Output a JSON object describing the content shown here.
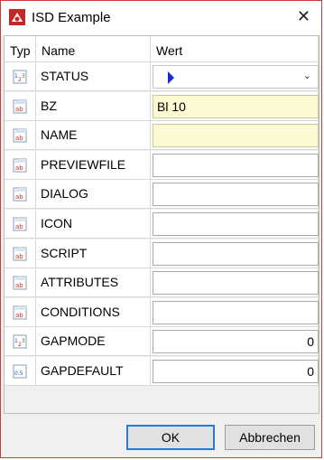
{
  "window": {
    "title": "ISD Example",
    "close_glyph": "✕"
  },
  "grid": {
    "headers": {
      "typ": "Typ",
      "name": "Name",
      "wert": "Wert"
    },
    "rows": [
      {
        "name": "STATUS",
        "icon": "numeric-value-icon",
        "value": "",
        "kind": "combo"
      },
      {
        "name": "BZ",
        "icon": "text-value-icon",
        "value": "Bl 10",
        "kind": "yellow"
      },
      {
        "name": "NAME",
        "icon": "text-value-icon",
        "value": "",
        "kind": "yellow"
      },
      {
        "name": "PREVIEWFILE",
        "icon": "text-value-icon",
        "value": "",
        "kind": "text"
      },
      {
        "name": "DIALOG",
        "icon": "text-value-icon",
        "value": "",
        "kind": "text"
      },
      {
        "name": "ICON",
        "icon": "text-value-icon",
        "value": "",
        "kind": "text"
      },
      {
        "name": "SCRIPT",
        "icon": "text-value-icon",
        "value": "",
        "kind": "text"
      },
      {
        "name": "ATTRIBUTES",
        "icon": "text-value-icon",
        "value": "",
        "kind": "text"
      },
      {
        "name": "CONDITIONS",
        "icon": "text-value-icon",
        "value": "",
        "kind": "text"
      },
      {
        "name": "GAPMODE",
        "icon": "numeric-value-icon",
        "value": "0",
        "kind": "number"
      },
      {
        "name": "GAPDEFAULT",
        "icon": "float-value-icon",
        "value": "0",
        "kind": "number"
      }
    ]
  },
  "buttons": {
    "ok": "OK",
    "cancel": "Abbrechen"
  },
  "colors": {
    "accent": "#2d7ad6",
    "title_border": "#cc3a3a",
    "highlight_field": "#fbfad2",
    "play_icon": "#1a2bd6"
  }
}
